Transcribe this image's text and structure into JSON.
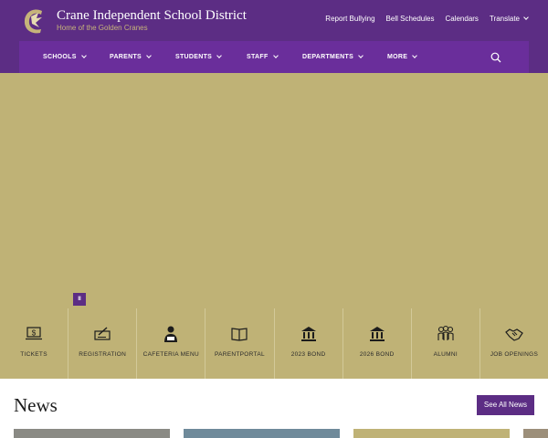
{
  "site": {
    "title": "Crane Independent School District",
    "tagline": "Home of the Golden Cranes"
  },
  "utility_nav": [
    "Report Bullying",
    "Bell Schedules",
    "Calendars",
    "Translate"
  ],
  "main_nav": [
    "SCHOOLS",
    "PARENTS",
    "STUDENTS",
    "STAFF",
    "DEPARTMENTS",
    "MORE"
  ],
  "hero": {
    "pause_label": "II"
  },
  "quick_links": [
    {
      "label": "TICKETS",
      "icon": "ticket-icon"
    },
    {
      "label": "REGISTRATION",
      "icon": "registration-icon"
    },
    {
      "label": "CAFETERIA MENU",
      "icon": "cafeteria-icon"
    },
    {
      "label": "PARENTPORTAL",
      "icon": "book-icon"
    },
    {
      "label": "2023 BOND",
      "icon": "building-icon"
    },
    {
      "label": "2026 BOND",
      "icon": "building-icon"
    },
    {
      "label": "ALUMNI",
      "icon": "people-icon"
    },
    {
      "label": "JOB OPENINGS",
      "icon": "handshake-icon"
    }
  ],
  "news": {
    "title": "News",
    "see_all_label": "See All News"
  },
  "colors": {
    "purple": "#5c2d84",
    "nav_purple": "#6a2e9b",
    "gold": "#bfb276",
    "gold_text": "#c6b47a"
  }
}
